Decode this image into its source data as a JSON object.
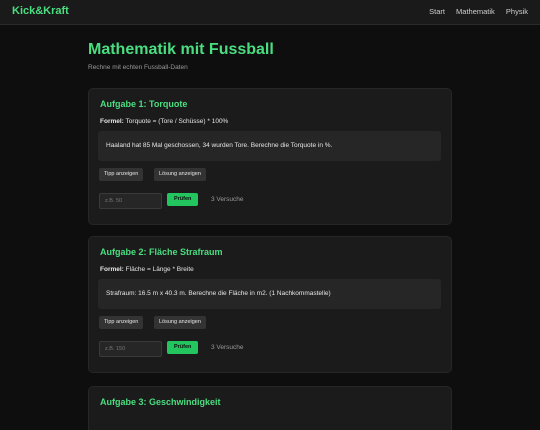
{
  "nav": {
    "brand": "Kick&Kraft",
    "links": [
      "Start",
      "Mathematik",
      "Physik"
    ]
  },
  "page": {
    "title": "Mathematik mit Fussball",
    "subtitle": "Rechne mit echten Fussball-Daten"
  },
  "tasks": [
    {
      "title": "Aufgabe 1: Torquote",
      "formula_label": "Formel:",
      "formula": "Torquote = (Tore / Schüsse) * 100%",
      "problem": "Haaland hat 85 Mal geschossen, 34 wurden Tore. Berechne die Torquote in %.",
      "hint_label": "Tipp anzeigen",
      "solution_label": "Lösung anzeigen",
      "placeholder": "z.B. 50",
      "check_label": "Prüfen",
      "attempts": "3 Versuche"
    },
    {
      "title": "Aufgabe 2: Fläche Strafraum",
      "formula_label": "Formel:",
      "formula": "Fläche = Länge * Breite",
      "problem": "Strafraum: 16.5 m x 40.3 m. Berechne die Fläche in m2. (1 Nachkommastelle)",
      "hint_label": "Tipp anzeigen",
      "solution_label": "Lösung anzeigen",
      "placeholder": "z.B. 150",
      "check_label": "Prüfen",
      "attempts": "3 Versuche"
    },
    {
      "title": "Aufgabe 3: Geschwindigkeit"
    }
  ]
}
